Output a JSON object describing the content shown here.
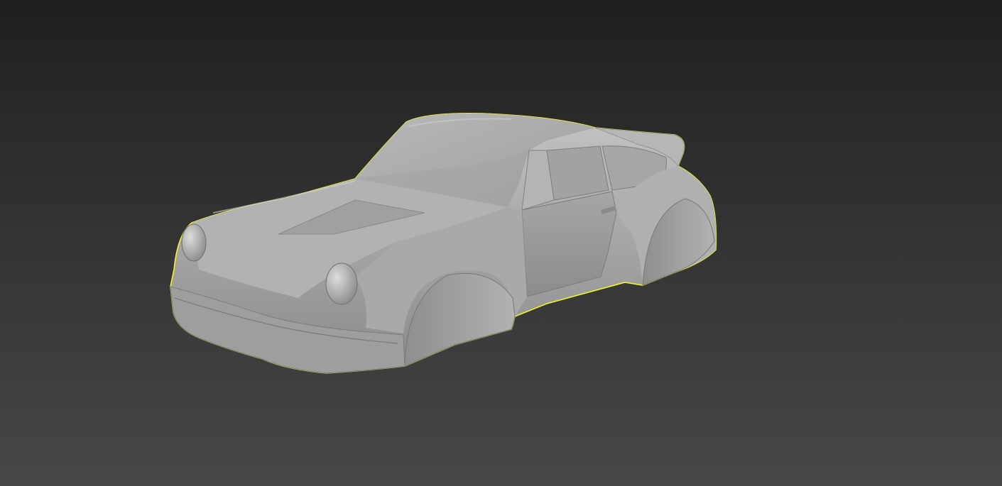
{
  "viewport": {
    "background_top": "#1f1f1f",
    "background_bottom": "#474747"
  },
  "model": {
    "object": "car-body-mesh",
    "selection_outline_color": "#f2f230",
    "body_color": "#a9a9a9",
    "selected": true
  }
}
